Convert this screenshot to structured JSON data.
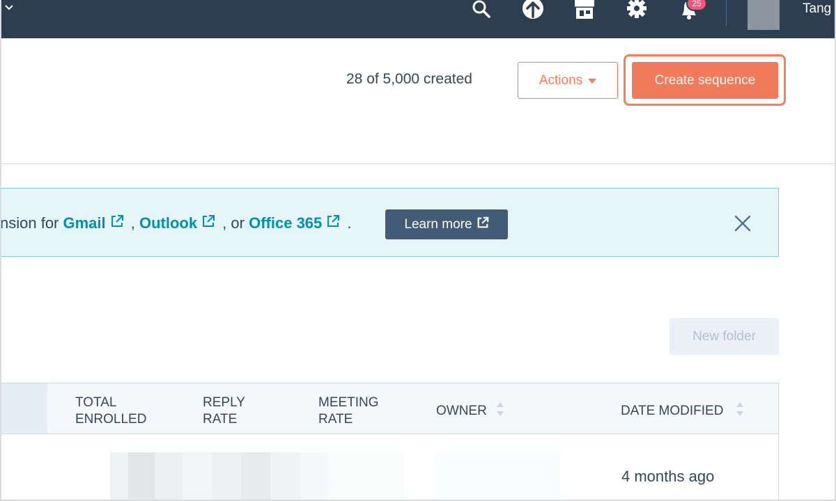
{
  "topnav": {
    "icons": [
      "chevron-down-icon",
      "search-icon",
      "upgrade-arrow-icon",
      "marketplace-icon",
      "settings-gear-icon",
      "notifications-bell-icon"
    ],
    "notification_count": "25",
    "user_name": "Tang"
  },
  "header": {
    "created_count": "28 of 5,000 created",
    "actions_label": "Actions",
    "create_label": "Create sequence"
  },
  "banner": {
    "prefix": "nsion for ",
    "gmail": "Gmail",
    "sep1": " , ",
    "outlook": "Outlook",
    "sep2": " , or ",
    "office": "Office 365",
    "suffix": " .",
    "learn_more": "Learn more"
  },
  "toolbar": {
    "new_folder": "New folder"
  },
  "table": {
    "columns": {
      "total_enrolled": [
        "TOTAL",
        "ENROLLED"
      ],
      "reply_rate": [
        "REPLY",
        "RATE"
      ],
      "meeting_rate": [
        "MEETING",
        "RATE"
      ],
      "owner": "OWNER",
      "date_modified": "DATE MODIFIED"
    },
    "rows": [
      {
        "date_modified": "4 months ago"
      }
    ]
  },
  "colors": {
    "nav_bg": "#2d3e50",
    "accent_orange": "#ff7a59",
    "link_teal": "#0091ae",
    "banner_bg": "#e5f5f8"
  }
}
